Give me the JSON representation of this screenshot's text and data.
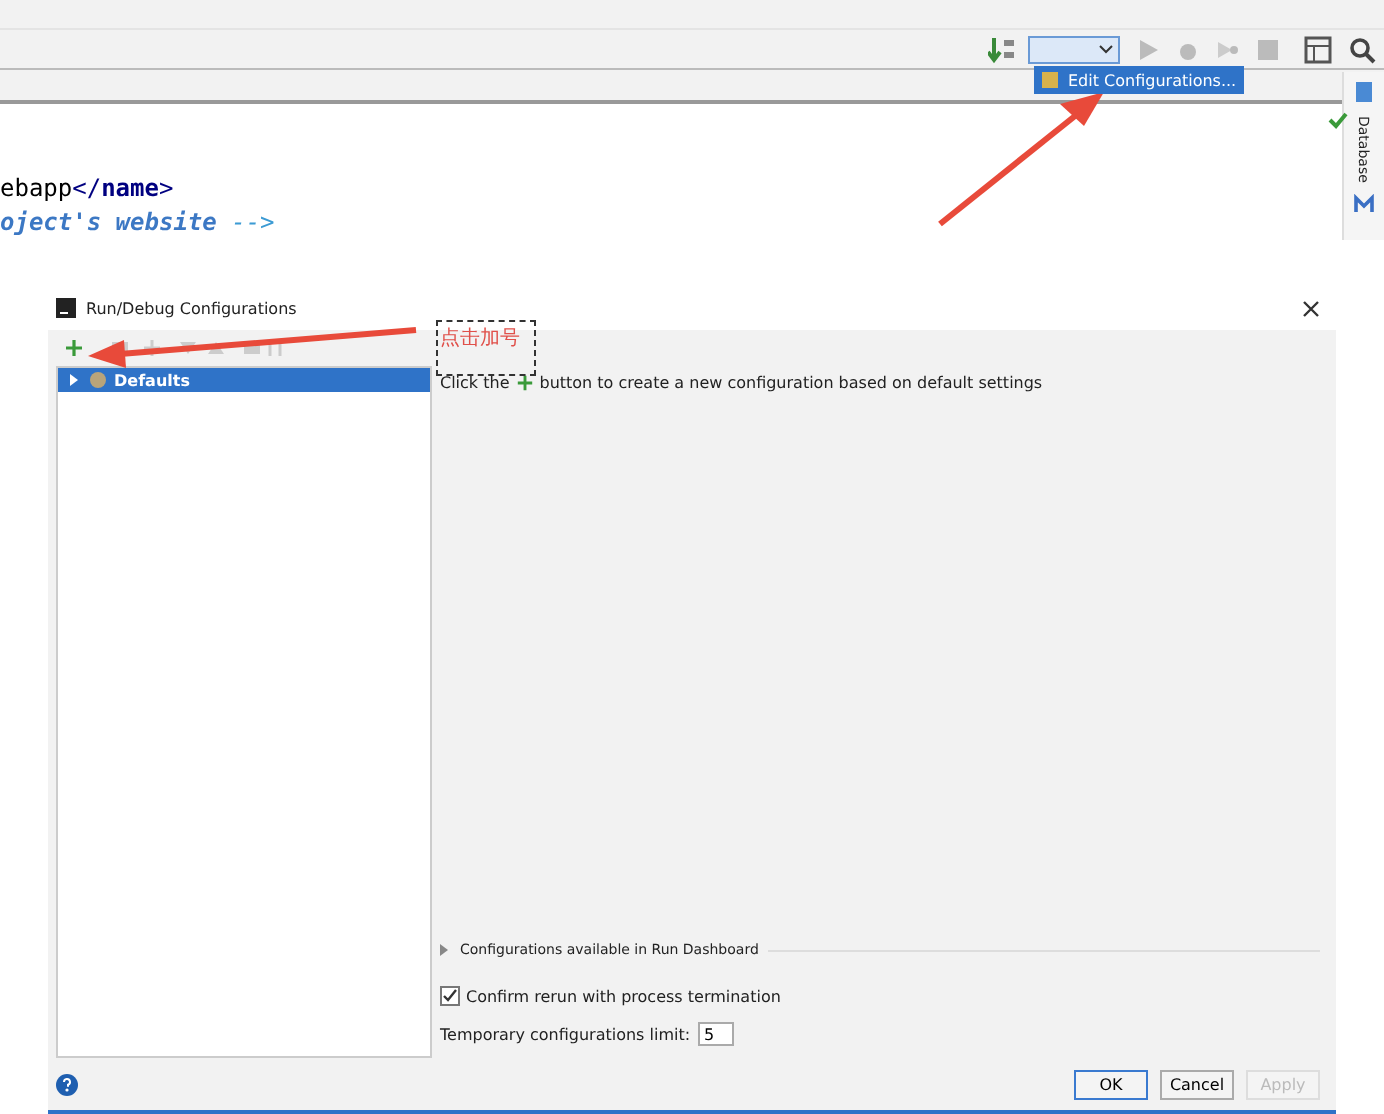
{
  "ide": {
    "popup_menu": {
      "items": [
        {
          "label": "Edit Configurations...",
          "selected": true
        }
      ]
    },
    "code_lines": [
      [
        {
          "kind": "text",
          "text": "ebapp"
        },
        {
          "kind": "tag",
          "text": "</"
        },
        {
          "kind": "tagname",
          "text": "name"
        },
        {
          "kind": "tag",
          "text": ">"
        }
      ],
      [
        {
          "kind": "comment",
          "text": "oject's website"
        },
        {
          "kind": "commentmark",
          "text": " -->"
        }
      ]
    ],
    "side_panel": {
      "label": "Database"
    }
  },
  "dialog": {
    "title": "Run/Debug Configurations",
    "tree": [
      {
        "label": "Defaults",
        "selected": true,
        "expanded": false
      }
    ],
    "hint": {
      "before": "Click the",
      "after": "button to create a new configuration based on default settings"
    },
    "dashboard_section": {
      "label": "Configurations available in Run Dashboard",
      "expanded": false
    },
    "confirm_rerun": {
      "label": "Confirm rerun with process termination",
      "checked": true
    },
    "temp_limit": {
      "label": "Temporary configurations limit:",
      "value": "5"
    },
    "buttons": [
      {
        "label": "OK",
        "kind": "default",
        "disabled": false
      },
      {
        "label": "Cancel",
        "kind": "normal",
        "disabled": false
      },
      {
        "label": "Apply",
        "kind": "normal",
        "disabled": true
      }
    ]
  },
  "annotation": {
    "text": "点击加号"
  }
}
